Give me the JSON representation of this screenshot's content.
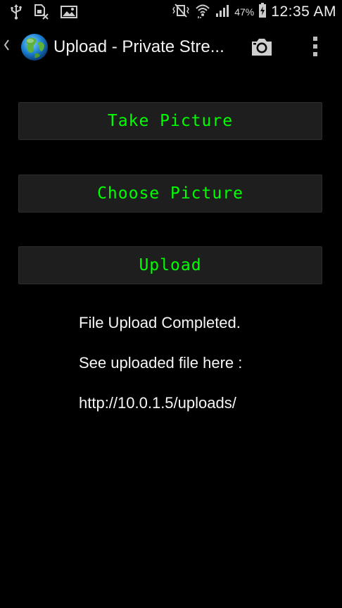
{
  "status_bar": {
    "icons_left": [
      "usb-icon",
      "sim-error-icon",
      "image-notification-icon"
    ],
    "icons_right": [
      "vibrate-mute-icon",
      "wifi-icon",
      "signal-icon",
      "battery-charging-icon"
    ],
    "battery_text": "47%",
    "time": "12:35 AM"
  },
  "action_bar": {
    "title": "Upload - Private Stre...",
    "app_icon": "globe-icon",
    "actions": [
      "camera-icon",
      "overflow-menu-icon"
    ]
  },
  "buttons": {
    "take_picture": "Take Picture",
    "choose_picture": "Choose Picture",
    "upload": "Upload"
  },
  "messages": {
    "line1": "File Upload Completed.",
    "line2": "See uploaded file here :",
    "line3": "http://10.0.1.5/uploads/"
  },
  "colors": {
    "background": "#000000",
    "button_background": "#1e1e1e",
    "button_text": "#00ff00",
    "text": "#f5f5f5"
  }
}
